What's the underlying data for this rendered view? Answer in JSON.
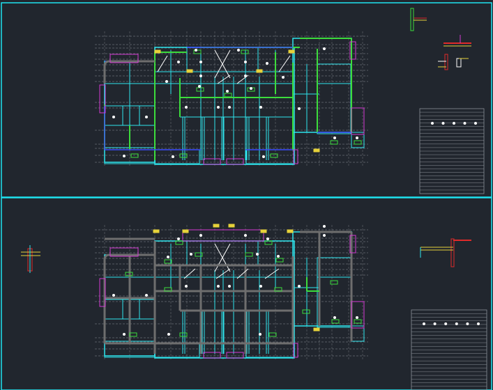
{
  "drawing": {
    "background": "#21262e",
    "frame_color": "#1fe3f0",
    "viewports": [
      {
        "id": "upper-plan"
      },
      {
        "id": "lower-plan"
      }
    ]
  },
  "palette": {
    "wall": "#2ee6ee",
    "column": "#3cdc3c",
    "beam_blue": "#3a4cff",
    "magenta": "#d23ad2",
    "yellow": "#e6d23a",
    "red": "#e02a2a",
    "grid": "#8a8f96",
    "white": "#ffffff",
    "grey_beam": "#6e6e6e"
  }
}
